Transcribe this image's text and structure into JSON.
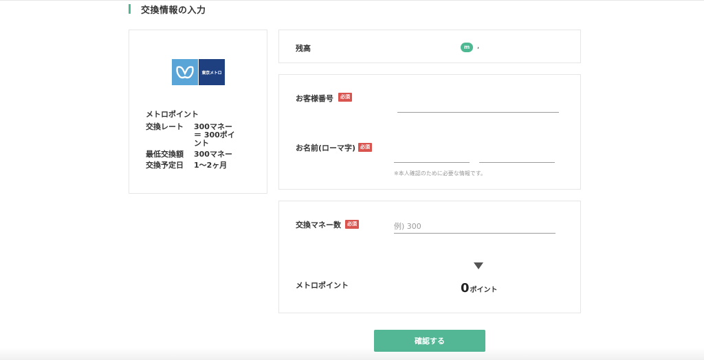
{
  "section": {
    "title": "交換情報の入力"
  },
  "partner": {
    "logo_text": "東京メトロ",
    "point_name": "メトロポイント",
    "details": [
      {
        "label": "交換レート",
        "value": "300マネー ＝ 300ポイント"
      },
      {
        "label": "最低交換額",
        "value": "300マネー"
      },
      {
        "label": "交換予定日",
        "value": "1〜2ヶ月"
      }
    ]
  },
  "balance": {
    "label": "残高",
    "coin_symbol": "m",
    "value": ","
  },
  "customer": {
    "number_label": "お客様番号",
    "required": "必須",
    "number_value": "",
    "name_label": "お名前(ローマ字)",
    "last_name_value": "",
    "first_name_value": "",
    "note": "※本人確認のために必要な情報です。"
  },
  "exchange": {
    "amount_label": "交換マネー数",
    "required": "必須",
    "amount_placeholder": "例) 300",
    "result_label": "メトロポイント",
    "result_value": "0",
    "result_unit": "ポイント"
  },
  "actions": {
    "confirm_label": "確認する"
  },
  "colors": {
    "accent": "#4db891",
    "required_badge": "#d9534f",
    "metro_blue": "#1e3f80",
    "metro_light": "#5aa5d8"
  }
}
